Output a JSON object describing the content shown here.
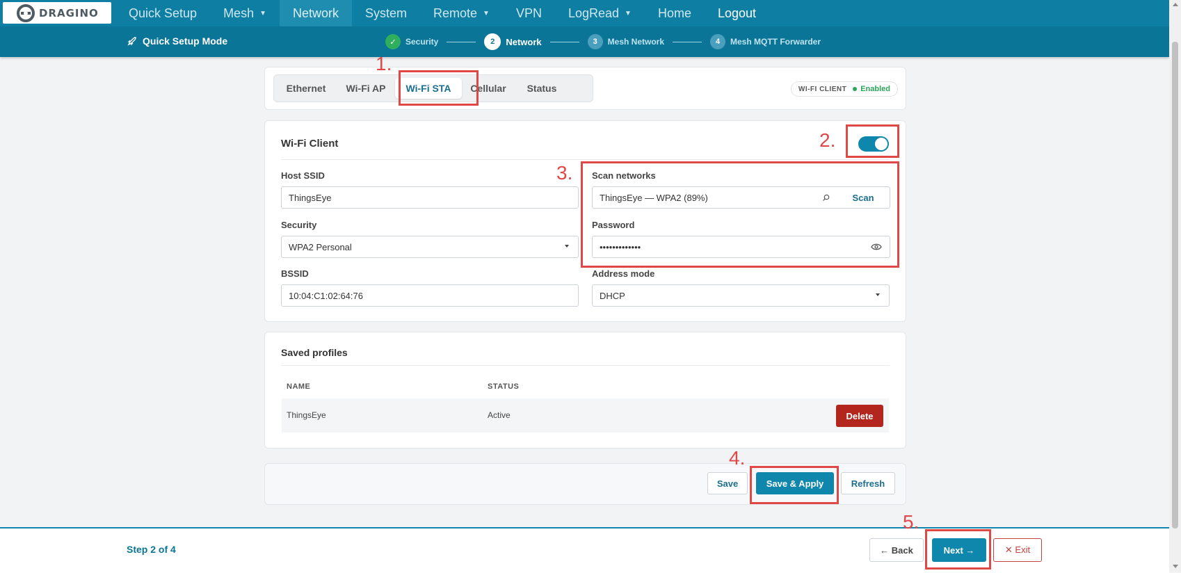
{
  "brand": {
    "logo_text": "DRAGINO"
  },
  "nav": {
    "items": [
      {
        "label": "Quick Setup",
        "caret": false,
        "active": false
      },
      {
        "label": "Mesh",
        "caret": true,
        "active": false
      },
      {
        "label": "Network",
        "caret": false,
        "active": true
      },
      {
        "label": "System",
        "caret": false,
        "active": false
      },
      {
        "label": "Remote",
        "caret": true,
        "active": false
      },
      {
        "label": "VPN",
        "caret": false,
        "active": false
      },
      {
        "label": "LogRead",
        "caret": true,
        "active": false
      },
      {
        "label": "Home",
        "caret": false,
        "active": false
      }
    ],
    "logout": "Logout"
  },
  "quick_setup": {
    "title": "Quick Setup Mode",
    "steps": [
      {
        "num": "✓",
        "label": "Security",
        "state": "done"
      },
      {
        "num": "2",
        "label": "Network",
        "state": "current"
      },
      {
        "num": "3",
        "label": "Mesh Network",
        "state": "pending"
      },
      {
        "num": "4",
        "label": "Mesh MQTT Forwarder",
        "state": "pending"
      }
    ]
  },
  "tabs": {
    "items": [
      "Ethernet",
      "Wi-Fi AP",
      "Wi-Fi STA",
      "Cellular",
      "Status"
    ],
    "active": "Wi-Fi STA",
    "badge_label": "WI-FI CLIENT",
    "badge_status": "Enabled"
  },
  "wifi_client": {
    "title": "Wi-Fi Client",
    "enabled": true,
    "host_ssid_label": "Host SSID",
    "host_ssid_value": "ThingsEye",
    "scan_label": "Scan networks",
    "scan_value": "ThingsEye — WPA2 (89%)",
    "scan_button": "Scan",
    "security_label": "Security",
    "security_value": "WPA2 Personal",
    "password_label": "Password",
    "password_value": "•••••••••••••",
    "bssid_label": "BSSID",
    "bssid_value": "10:04:C1:02:64:76",
    "address_mode_label": "Address mode",
    "address_mode_value": "DHCP"
  },
  "profiles": {
    "title": "Saved profiles",
    "columns": [
      "NAME",
      "STATUS"
    ],
    "rows": [
      {
        "name": "ThingsEye",
        "status": "Active",
        "action": "Delete"
      }
    ]
  },
  "actions": {
    "save": "Save",
    "save_apply": "Save & Apply",
    "refresh": "Refresh"
  },
  "footer": {
    "step_text": "Step 2 of 4",
    "back": "← Back",
    "next": "Next →",
    "exit": "✕ Exit"
  },
  "annotations": [
    "1.",
    "2.",
    "3.",
    "4.",
    "5."
  ],
  "colors": {
    "nav": "#0e7fa3",
    "subbar": "#0a7597",
    "accent": "#0f87ad",
    "danger": "#b3261e",
    "annotation": "#e04848"
  }
}
